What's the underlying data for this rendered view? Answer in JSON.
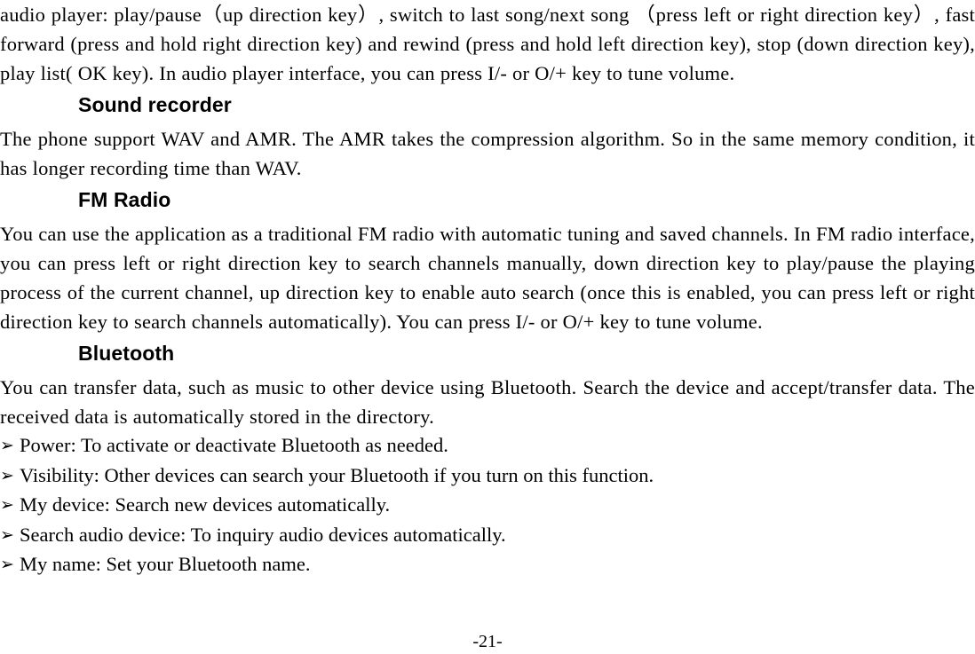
{
  "document": {
    "page_number_label": "-21-"
  },
  "blocks": {
    "intro_paragraph": "audio player: play/pause（up direction key）, switch to last song/next song （press left or right direction key）, fast forward (press and hold right direction key) and rewind (press and hold left direction key), stop (down direction key), play list( OK key). In audio player interface, you can press I/- or O/+ key to tune volume.",
    "sound_recorder": {
      "heading": "Sound recorder",
      "paragraph": "The phone support WAV and AMR. The AMR takes the compression algorithm. So in the same memory condition, it has longer recording time than WAV."
    },
    "fm_radio": {
      "heading": "FM Radio",
      "paragraph": "You can use the application as a traditional FM radio with automatic tuning and saved channels. In FM radio interface, you can press left or right direction key to search channels manually, down direction key to play/pause the playing process of the current channel, up direction key to enable auto search (once this is enabled, you can press left or right direction key to search channels automatically). You can press I/- or O/+ key to tune volume."
    },
    "bluetooth": {
      "heading": "Bluetooth",
      "paragraph": "You can transfer data, such as music to other device using Bluetooth. Search the device and accept/transfer data. The received data is automatically stored in the directory.",
      "bullet_glyph": "➢",
      "items": [
        "Power: To activate or deactivate Bluetooth as needed.",
        "Visibility: Other devices can search your Bluetooth if you turn on this function.",
        "My device: Search new devices automatically.",
        "Search audio device: To inquiry audio devices automatically.",
        "My name: Set your Bluetooth name."
      ]
    }
  }
}
